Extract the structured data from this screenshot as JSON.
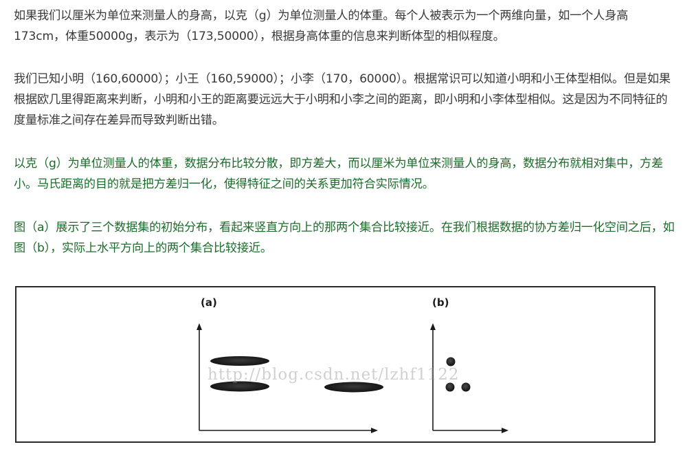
{
  "paragraphs": {
    "p1": "如果我们以厘米为单位来测量人的身高，以克（g）为单位测量人的体重。每个人被表示为一个两维向量，如一个人身高173cm，体重50000g，表示为（173,50000），根据身高体重的信息来判断体型的相似程度。",
    "p2": "我们已知小明（160,60000）；小王（160,59000）；小李（170，60000）。根据常识可以知道小明和小王体型相似。但是如果根据欧几里得距离来判断，小明和小王的距离要远远大于小明和小李之间的距离，即小明和小李体型相似。这是因为不同特征的度量标准之间存在差异而导致判断出错。",
    "p3": "以克（g）为单位测量人的体重，数据分布比较分散，即方差大，而以厘米为单位来测量人的身高，数据分布就相对集中，方差小。马氏距离的目的就是把方差归一化，使得特征之间的关系更加符合实际情况。",
    "p4": "图（a）展示了三个数据集的初始分布，看起来竖直方向上的那两个集合比较接近。在我们根据数据的协方差归一化空间之后，如图（b），实际上水平方向上的两个集合比较接近。"
  },
  "figure": {
    "panel_a_label": "(a)",
    "panel_b_label": "(b)",
    "watermark": "http://blog.csdn.net/lzhf1122",
    "colors": {
      "border": "#2a2a2a",
      "axis": "#1a1a1a",
      "cluster": "#1e1e1e"
    }
  }
}
